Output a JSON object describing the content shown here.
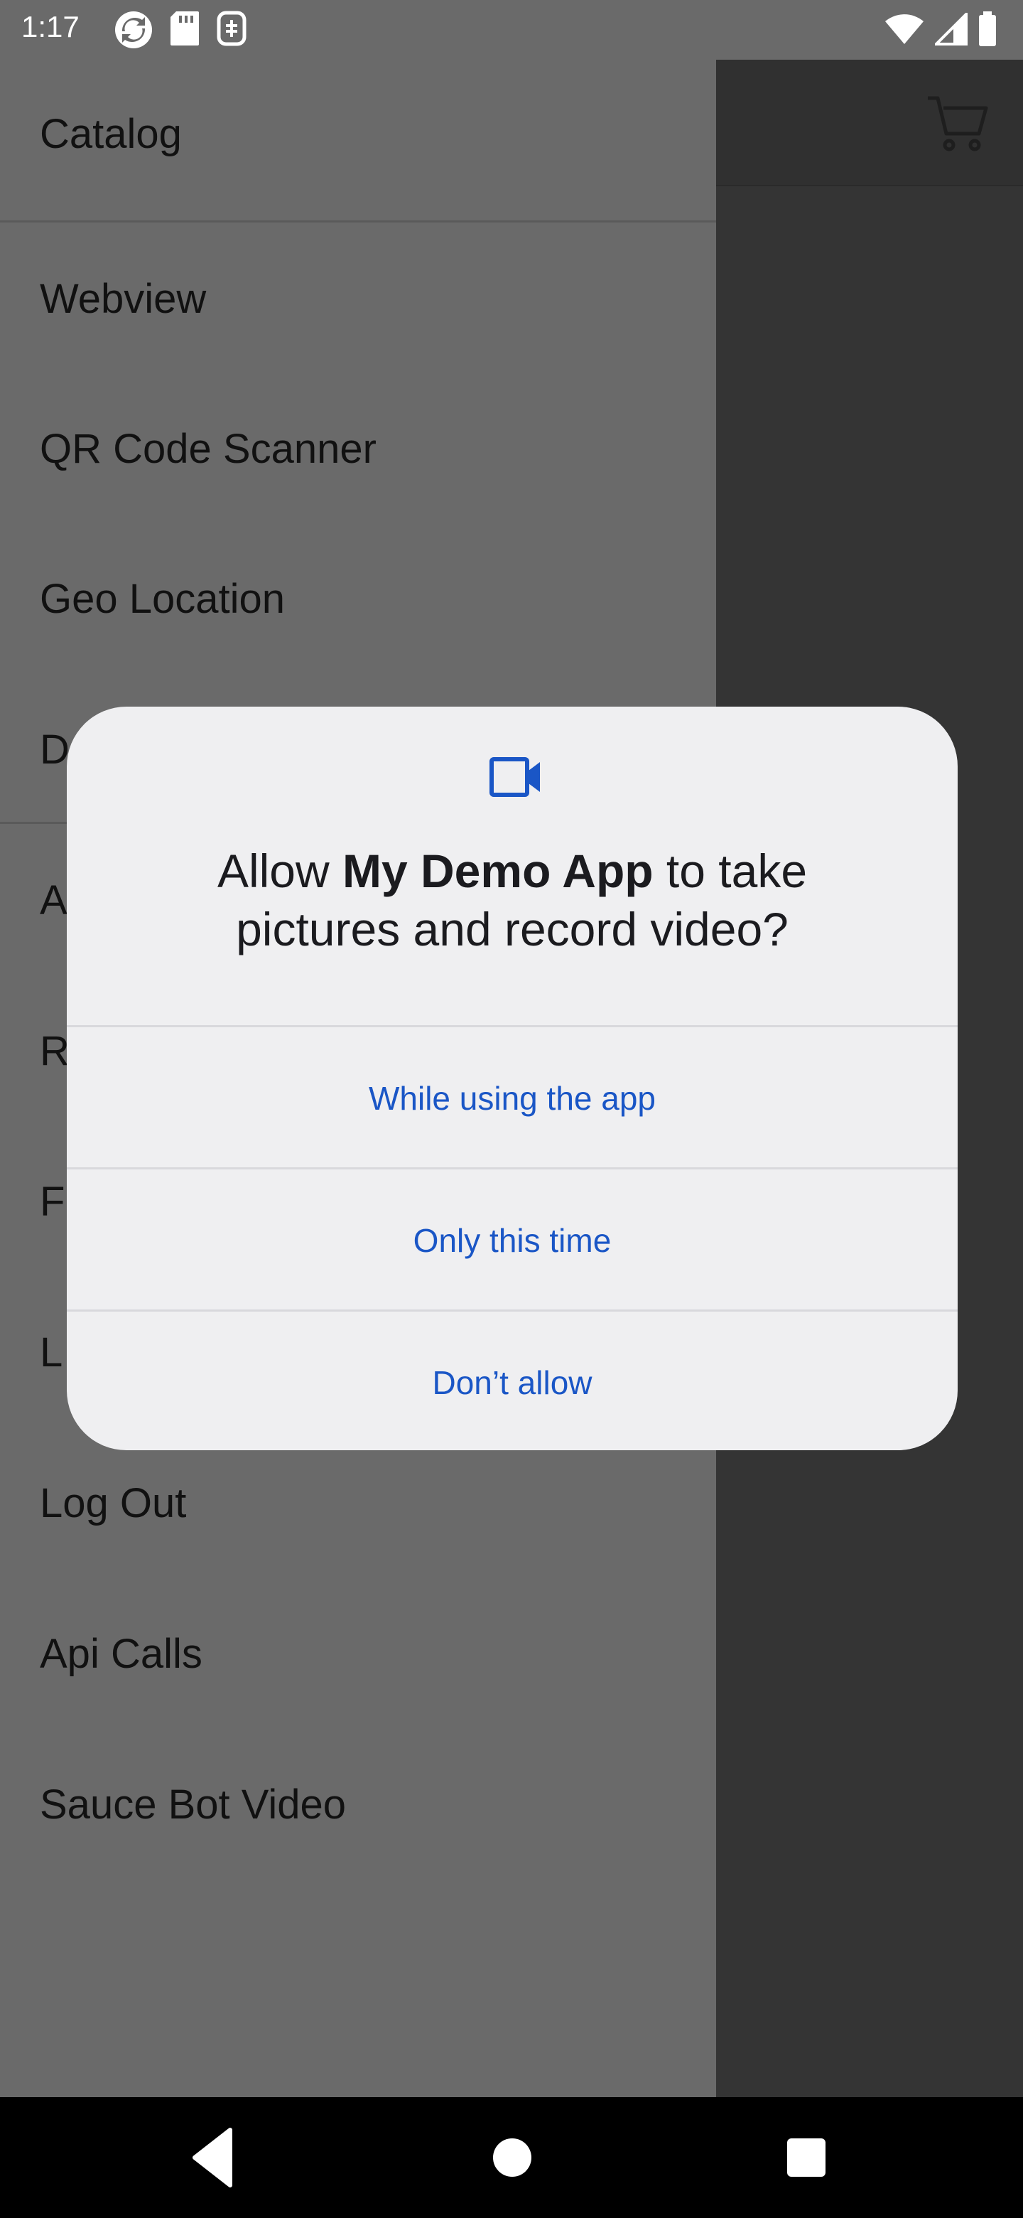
{
  "status_bar": {
    "time": "1:17",
    "left_icons": [
      "sync-icon",
      "sd-card-icon",
      "notification-icon"
    ],
    "right_icons": [
      "wifi-icon",
      "cell-signal-icon",
      "battery-icon"
    ]
  },
  "drawer": {
    "items": [
      {
        "label": "Catalog"
      },
      {
        "label": "Webview"
      },
      {
        "label": "QR Code Scanner"
      },
      {
        "label": "Geo Location"
      },
      {
        "label": "D"
      },
      {
        "label": "A"
      },
      {
        "label": "R"
      },
      {
        "label": "F"
      },
      {
        "label": "L"
      },
      {
        "label": "Log Out"
      },
      {
        "label": "Api Calls"
      },
      {
        "label": "Sauce Bot Video"
      }
    ]
  },
  "header": {
    "cart_icon": "cart-icon"
  },
  "dialog": {
    "icon": "video-camera-icon",
    "title_prefix": "Allow ",
    "app_name": "My Demo App",
    "title_suffix_line1": " to take",
    "title_line2": "pictures and record video?",
    "buttons": {
      "while_using": "While using the app",
      "only_this_time": "Only this time",
      "dont_allow": "Don’t allow"
    },
    "accent_color": "#1a56c6"
  },
  "nav_bar": {
    "buttons": [
      "back-icon",
      "home-icon",
      "recents-icon"
    ]
  }
}
